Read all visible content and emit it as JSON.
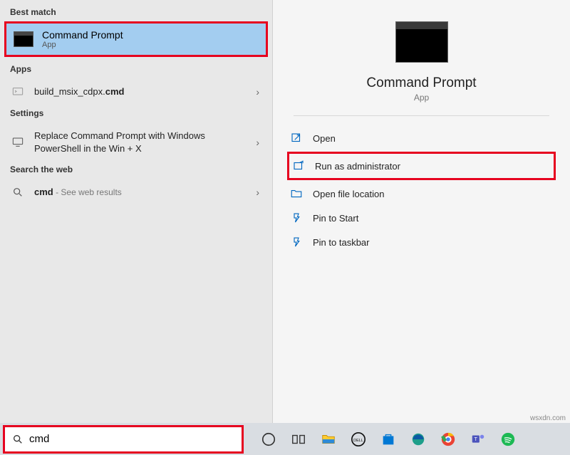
{
  "left": {
    "best_match_header": "Best match",
    "best_match": {
      "title": "Command Prompt",
      "sub": "App"
    },
    "apps_header": "Apps",
    "apps_item_prefix": "build_msix_cdpx.",
    "apps_item_bold": "cmd",
    "settings_header": "Settings",
    "settings_item": "Replace Command Prompt with Windows PowerShell in the Win + X",
    "web_header": "Search the web",
    "web_item_bold": "cmd",
    "web_item_suffix": " - See web results"
  },
  "right": {
    "title": "Command Prompt",
    "sub": "App",
    "actions": {
      "open": "Open",
      "run_admin": "Run as administrator",
      "open_loc": "Open file location",
      "pin_start": "Pin to Start",
      "pin_taskbar": "Pin to taskbar"
    }
  },
  "search": {
    "value": "cmd"
  },
  "watermark": "wsxdn.com"
}
